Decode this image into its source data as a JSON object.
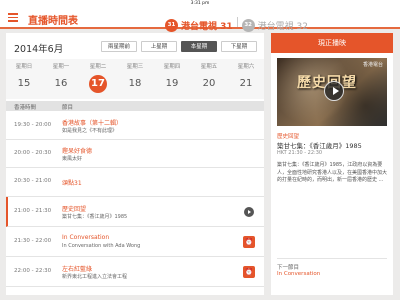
{
  "statusbar": {
    "time": "3:31 pm"
  },
  "header": {
    "title": "直播時間表",
    "channels": [
      {
        "logo": "31",
        "name": "港台電視 31",
        "active": true
      },
      {
        "logo": "32",
        "name": "港台電視 32",
        "active": false
      }
    ]
  },
  "schedule": {
    "month": "2014年6月",
    "week_nav": {
      "prev2": "兩星期前",
      "prev1": "上星期",
      "current": "本星期",
      "next": "下星期"
    },
    "days": [
      {
        "weekday": "星期日",
        "date": "15"
      },
      {
        "weekday": "星期一",
        "date": "16"
      },
      {
        "weekday": "星期二",
        "date": "17",
        "selected": true
      },
      {
        "weekday": "星期三",
        "date": "18"
      },
      {
        "weekday": "星期四",
        "date": "19"
      },
      {
        "weekday": "星期五",
        "date": "20"
      },
      {
        "weekday": "星期六",
        "date": "21"
      }
    ],
    "columns": {
      "time": "香港時間",
      "program": "節目"
    },
    "rows": [
      {
        "time": "19:30 - 20:00",
        "title": "香港故事（第十二輯）",
        "sub": "如是我見之《不有此理》",
        "action": "none"
      },
      {
        "time": "20:00 - 20:30",
        "title": "鏗呆好食德",
        "sub": "東風太好",
        "action": "none"
      },
      {
        "time": "20:30 - 21:00",
        "title": "頌點31",
        "sub": "",
        "action": "none"
      },
      {
        "time": "21:00 - 21:30",
        "title": "歷史回望",
        "sub": "築甘七集：《香江歲月》1985",
        "action": "play",
        "current": true
      },
      {
        "time": "21:30 - 22:00",
        "title": "In Conversation",
        "sub": "In Conversation with Ada Wong",
        "action": "alarm"
      },
      {
        "time": "22:00 - 22:30",
        "title": "左右紅藍綠",
        "sub": "新界東北工程進入立法會工程",
        "action": "alarm"
      }
    ]
  },
  "live": {
    "button": "現正播映",
    "thumb_title": "歷史回望",
    "thumb_tag": "香港電台",
    "category": "歷史回望",
    "title": "築甘七集：《香江歲月》1985",
    "time": "HKT 21:30 - 22:30",
    "description": "築甘七集：《香江歲月》1985，江政府以資為要人，全面性地研究香港人以及，在美國香港中加大的打量在紀時的，而明出，新一屆香港的歷史 ...",
    "next_label": "下一節目",
    "next_title": "In Conversation"
  }
}
